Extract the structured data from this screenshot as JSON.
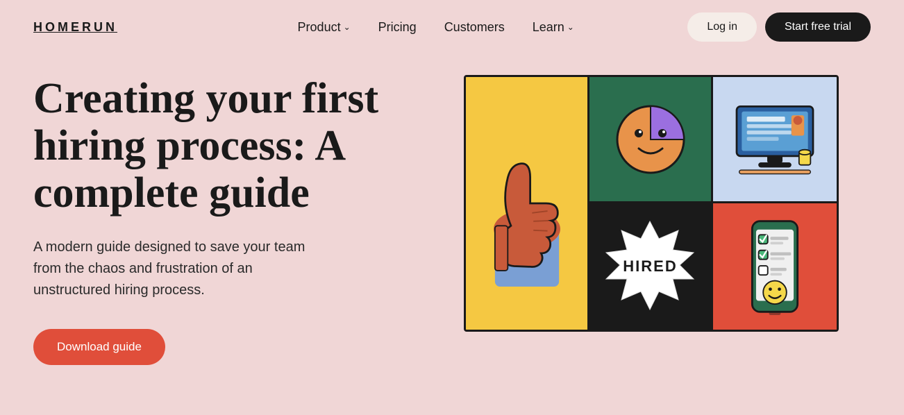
{
  "nav": {
    "logo": "HOMERUN",
    "links": [
      {
        "label": "Product",
        "hasDropdown": true,
        "id": "product"
      },
      {
        "label": "Pricing",
        "hasDropdown": false,
        "id": "pricing"
      },
      {
        "label": "Customers",
        "hasDropdown": false,
        "id": "customers"
      },
      {
        "label": "Learn",
        "hasDropdown": true,
        "id": "learn"
      }
    ],
    "login_label": "Log in",
    "trial_label": "Start free trial"
  },
  "hero": {
    "title": "Creating your first hiring process: A complete guide",
    "subtitle": "A modern guide designed to save your team from the chaos and frustration of an unstructured hiring process.",
    "cta_label": "Download guide"
  },
  "colors": {
    "background": "#f0d6d6",
    "accent_red": "#e04e3a",
    "dark": "#1a1a1a",
    "cell_yellow": "#f5c842",
    "cell_green": "#2a6e4e",
    "cell_blue": "#c8d8f0",
    "cell_black": "#1a1a1a"
  }
}
